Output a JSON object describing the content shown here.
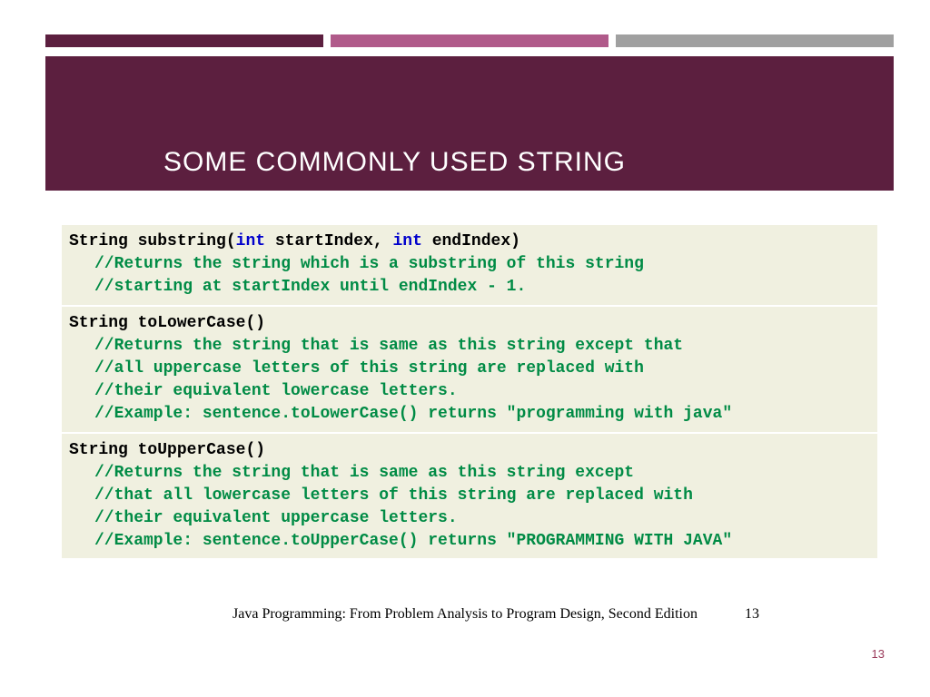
{
  "header": {
    "title": "SOME COMMONLY USED STRING"
  },
  "methods": [
    {
      "sig_prefix": "String ",
      "sig_name": "substring",
      "sig_open": "(",
      "params": [
        {
          "type": "int",
          "name": " startIndex, "
        },
        {
          "type": "int",
          "name": " endIndex"
        }
      ],
      "sig_close": ")",
      "comments": [
        "//Returns the string which is a substring of this string",
        "//starting at startIndex until endIndex - 1."
      ]
    },
    {
      "sig_prefix": "String ",
      "sig_name": "toLowerCase",
      "sig_open": "(",
      "params": [],
      "sig_close": ")",
      "comments": [
        "//Returns the string that is same as this string except that",
        "//all uppercase letters of this string are replaced with",
        "//their equivalent lowercase letters.",
        "//Example: sentence.toLowerCase() returns \"programming with java\""
      ]
    },
    {
      "sig_prefix": "String ",
      "sig_name": "toUpperCase",
      "sig_open": "(",
      "params": [],
      "sig_close": ")",
      "comments": [
        "//Returns the string that is same as this string except",
        "//that all lowercase letters of this string are replaced with",
        "//their equivalent uppercase letters.",
        "//Example: sentence.toUpperCase() returns \"PROGRAMMING WITH JAVA\""
      ]
    }
  ],
  "footer": {
    "book": "Java Programming: From Problem Analysis to Program Design, Second Edition",
    "page_inline": "13",
    "page_corner": "13"
  }
}
